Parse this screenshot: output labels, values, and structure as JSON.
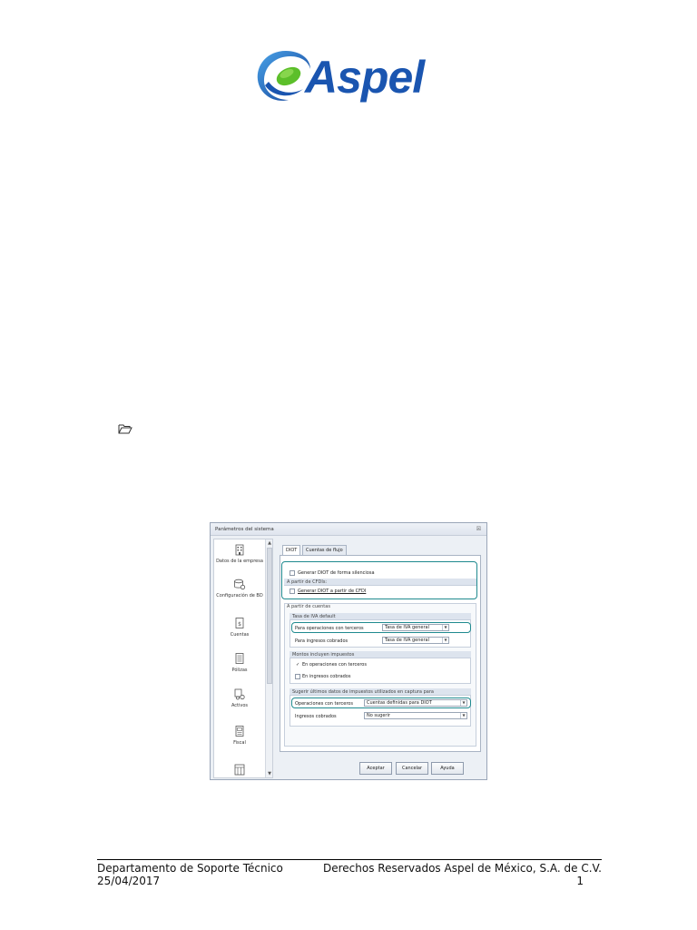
{
  "logo": {
    "brand": "Aspel"
  },
  "dialog": {
    "title": "Parámetros del sistema",
    "close": "☒",
    "sidebar": [
      {
        "label": "Datos de la empresa",
        "icon": "building-icon"
      },
      {
        "label": "Configuración de BD",
        "icon": "database-gear-icon"
      },
      {
        "label": "Cuentas",
        "icon": "ledger-icon"
      },
      {
        "label": "Pólizas",
        "icon": "document-icon"
      },
      {
        "label": "Activos",
        "icon": "asset-icon"
      },
      {
        "label": "Fiscal",
        "icon": "fiscal-document-icon"
      }
    ],
    "tabs": [
      "DIOT",
      "Cuentas de flujo"
    ],
    "generar_silenciosa": "Generar DIOT de forma silenciosa",
    "cfdi_header": "A partir de CFDIs:",
    "generar_cfdi": "Generar DIOT a partir de CFDI",
    "cuentas_header": "A partir de cuentas",
    "tasa_header": "Tasa de IVA default",
    "ops_terceros_label": "Para operaciones con terceros",
    "ops_terceros_value": "Tasa de IVA general",
    "ingresos_label": "Para ingresos cobrados",
    "ingresos_value": "Tasa de IVA general",
    "montos_header": "Montos incluyen impuestos",
    "montos_ops": "En operaciones con terceros",
    "montos_ingresos": "En ingresos cobrados",
    "sugerir_header": "Sugerir últimos datos de impuestos utilizados en captura para",
    "sug_ops_label": "Operaciones con terceros",
    "sug_ops_value": "Cuentas definidas para DIOT",
    "sug_ing_label": "Ingresos cobrados",
    "sug_ing_value": "No sugerir",
    "buttons": {
      "ok": "Aceptar",
      "cancel": "Cancelar",
      "help": "Ayuda"
    }
  },
  "footer": {
    "dept": "Departamento de Soporte Técnico",
    "date": "25/04/2017",
    "rights": "Derechos Reservados Aspel de México, S.A. de C.V.",
    "page": "1"
  }
}
